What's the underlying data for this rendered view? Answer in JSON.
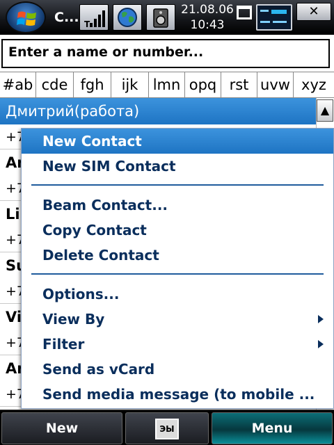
{
  "titlebar": {
    "app_title": "C...",
    "date": "21.08.06",
    "time": "10:43",
    "close_label": "✕"
  },
  "search": {
    "value": "Enter a name or number..."
  },
  "alpha_tabs": [
    "#ab",
    "cde",
    "fgh",
    "ijk",
    "lmn",
    "opq",
    "rst",
    "uvw",
    "xyz"
  ],
  "contacts": [
    {
      "name": "Дмитрий(работа)",
      "phone": "+7",
      "selected": true
    },
    {
      "name": "An",
      "phone": "+7"
    },
    {
      "name": "Li",
      "phone": "+7"
    },
    {
      "name": "Su",
      "phone": "+7"
    },
    {
      "name": "Vi",
      "phone": "+7"
    },
    {
      "name": "An",
      "phone": "+7"
    }
  ],
  "menu": {
    "group1": [
      "New Contact",
      "New SIM Contact"
    ],
    "group2": [
      "Beam Contact...",
      "Copy Contact",
      "Delete Contact"
    ],
    "group3": [
      "Options...",
      "View By",
      "Filter",
      "Send as vCard",
      "Send media message (to mobile ..."
    ]
  },
  "softkeys": {
    "left": "New",
    "keyboard_glyph": "ЭЫ",
    "right": "Menu"
  },
  "colors": {
    "selection": "#1e74c3",
    "menu_text": "#0a2e5c",
    "title_bar": "#15171b"
  },
  "icons": [
    "windows-start-icon",
    "signal-icon",
    "globe-icon",
    "volume-icon",
    "connectivity-icon",
    "keyboard-icon",
    "scroll-up-icon",
    "submenu-arrow-icon"
  ]
}
